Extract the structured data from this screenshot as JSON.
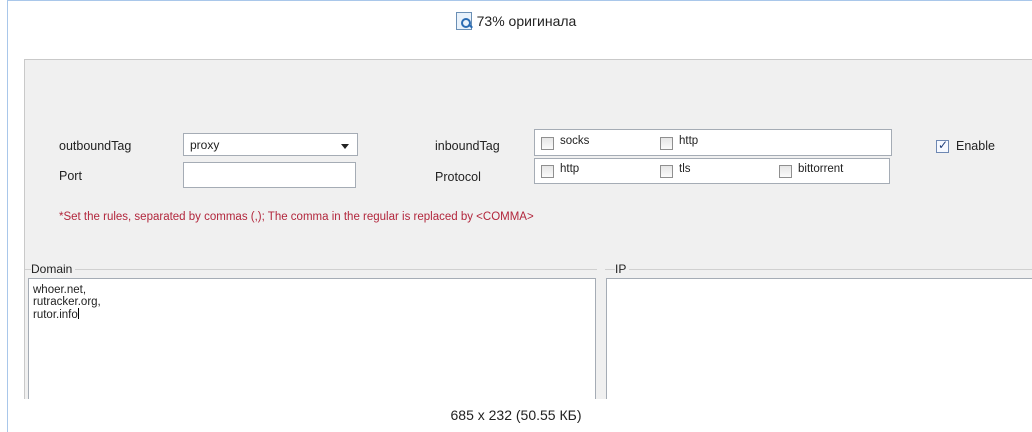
{
  "caption": {
    "icon": "zoom-icon",
    "text": "73% оригинала"
  },
  "form": {
    "outbound_tag_label": "outboundTag",
    "outbound_tag_value": "proxy",
    "inbound_tag_label": "inboundTag",
    "inbound_options": [
      {
        "label": "socks",
        "checked": false
      },
      {
        "label": "http",
        "checked": false
      }
    ],
    "enable_label": "Enable",
    "enable_checked": true,
    "port_label": "Port",
    "port_value": "",
    "protocol_label": "Protocol",
    "protocol_options": [
      {
        "label": "http",
        "checked": false
      },
      {
        "label": "tls",
        "checked": false
      },
      {
        "label": "bittorrent",
        "checked": false
      }
    ],
    "note": "*Set the rules, separated by commas (,); The comma in the regular is replaced by <COMMA>"
  },
  "domain": {
    "label": "Domain",
    "lines": [
      "whoer.net,",
      "rutracker.org,",
      "rutor.info"
    ]
  },
  "ip": {
    "label": "IP",
    "lines": []
  },
  "footer": {
    "text": "685 x 232 (50.55 КБ)"
  },
  "colors": {
    "note": "#b2263c",
    "panel": "#f0f0f0",
    "frame": "#a9c7ea"
  }
}
